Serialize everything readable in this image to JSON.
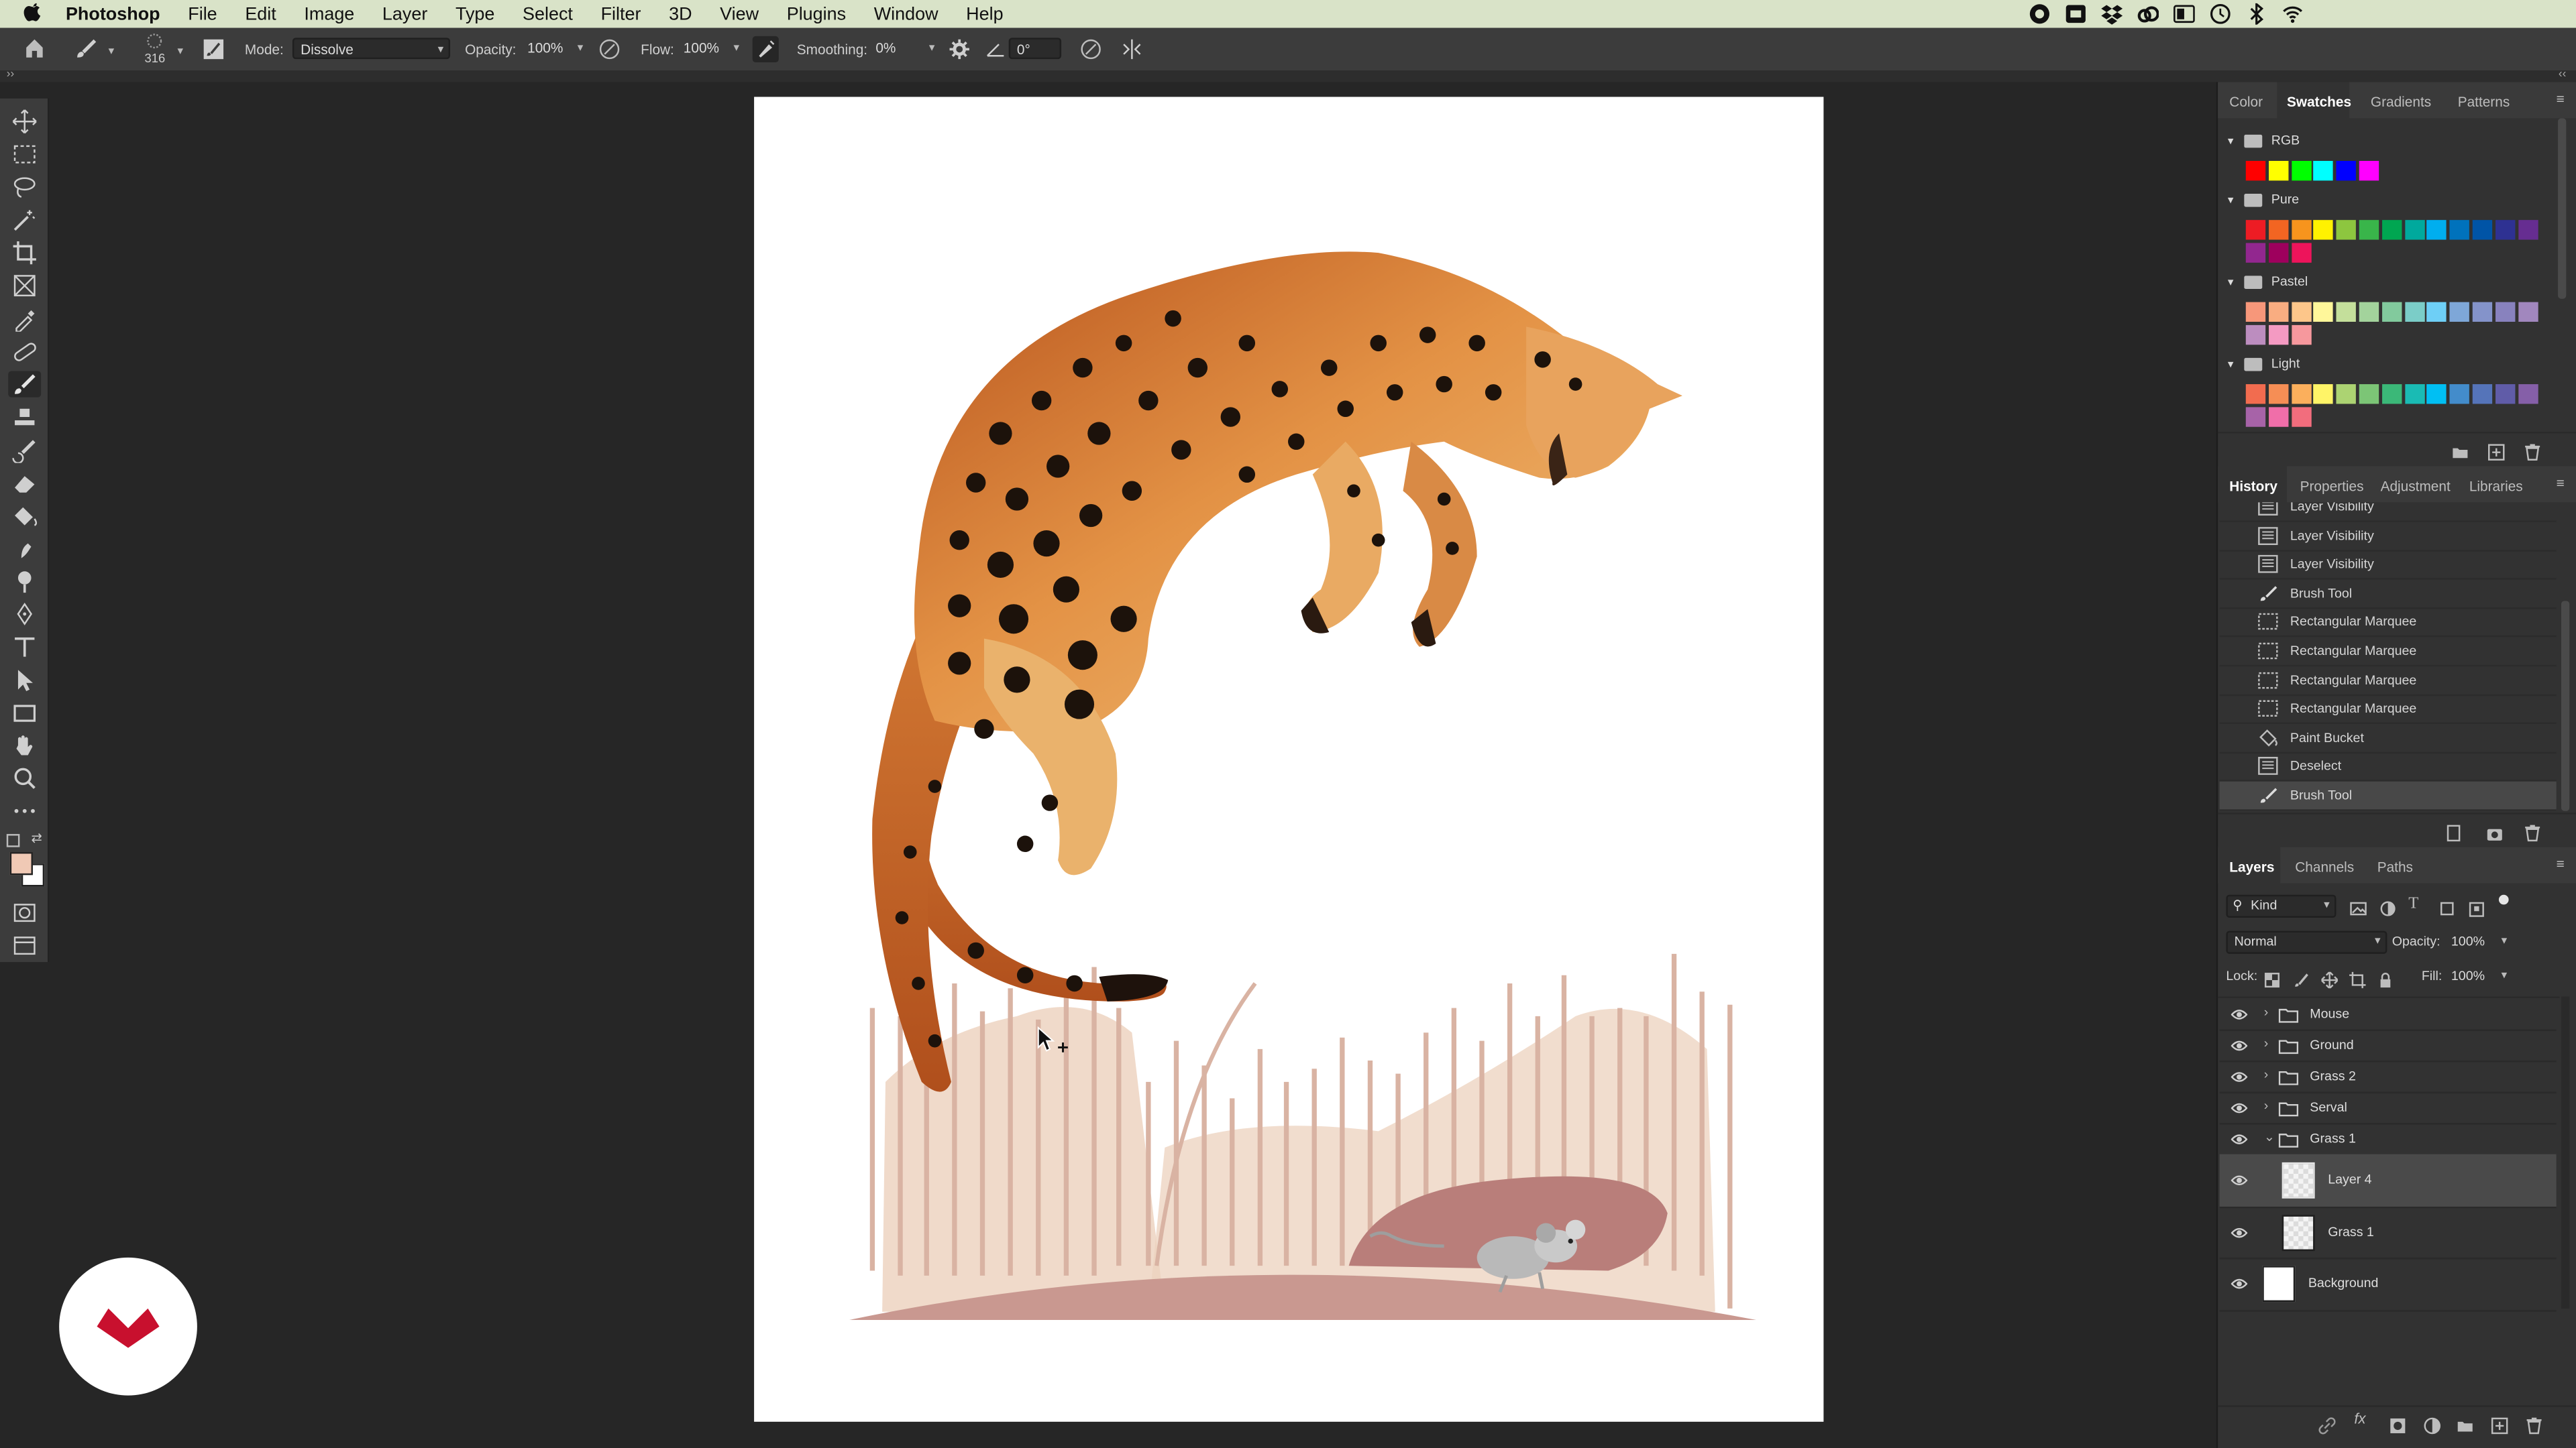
{
  "menubar": {
    "app_name": "Photoshop",
    "items": [
      "File",
      "Edit",
      "Image",
      "Layer",
      "Type",
      "Select",
      "Filter",
      "3D",
      "View",
      "Plugins",
      "Window",
      "Help"
    ],
    "bg_color": "#d9e3c8"
  },
  "options_bar": {
    "brush_size": "316",
    "mode_label": "Mode:",
    "mode_value": "Dissolve",
    "opacity_label": "Opacity:",
    "opacity_value": "100%",
    "flow_label": "Flow:",
    "flow_value": "100%",
    "smoothing_label": "Smoothing:",
    "smoothing_value": "0%",
    "angle_value": "0°"
  },
  "toolbar": {
    "tools": [
      "move-tool",
      "marquee-tool",
      "lasso-tool",
      "magic-wand-tool",
      "crop-tool",
      "frame-tool",
      "eyedropper-tool",
      "healing-tool",
      "brush-tool",
      "stamp-tool",
      "history-brush-tool",
      "eraser-tool",
      "paint-bucket-tool",
      "smudge-tool",
      "dodge-tool",
      "pen-tool",
      "type-tool",
      "path-selection-tool",
      "rectangle-tool",
      "hand-tool",
      "zoom-tool",
      "more-tools"
    ],
    "active_tool": "brush-tool",
    "foreground_color": "#f0c9b5",
    "background_color": "#ffffff"
  },
  "swatches_panel": {
    "tabs": [
      "Color",
      "Swatches",
      "Gradients",
      "Patterns"
    ],
    "active_tab": "Swatches",
    "groups": [
      {
        "name": "RGB",
        "colors": [
          "#ff0000",
          "#ffff00",
          "#00ff00",
          "#00ffff",
          "#0000ff",
          "#ff00ff"
        ]
      },
      {
        "name": "Pure",
        "colors": [
          "#ed1c24",
          "#f26522",
          "#f7941d",
          "#fff200",
          "#8dc63f",
          "#39b54a",
          "#00a651",
          "#00a99d",
          "#00aeef",
          "#0072bc",
          "#0054a6",
          "#2e3192",
          "#662d91",
          "#92278f",
          "#9e005d",
          "#ed145b"
        ]
      },
      {
        "name": "Pastel",
        "colors": [
          "#f7977a",
          "#f9ad81",
          "#fdc68a",
          "#fff79a",
          "#c4df9b",
          "#a3d39c",
          "#82ca9d",
          "#7bcdc8",
          "#6ecff6",
          "#7ea7d8",
          "#8493ca",
          "#8882be",
          "#a187be",
          "#bc8dbf",
          "#f49ac2",
          "#f6989d"
        ]
      },
      {
        "name": "Light",
        "colors": [
          "#f26c4f",
          "#f68e55",
          "#fbaf5c",
          "#fff467",
          "#acd372",
          "#7cc576",
          "#3bb878",
          "#1abbb4",
          "#00bff3",
          "#438ccb",
          "#5574b9",
          "#605ca8",
          "#855fa8",
          "#a763a8",
          "#f06ea9",
          "#f26d7d"
        ]
      }
    ]
  },
  "history_panel": {
    "tabs": [
      "History",
      "Properties",
      "Adjustment",
      "Libraries"
    ],
    "active_tab": "History",
    "items": [
      {
        "label": "Layer Visibility",
        "icon": "document-icon"
      },
      {
        "label": "Layer Visibility",
        "icon": "document-icon"
      },
      {
        "label": "Layer Visibility",
        "icon": "document-icon"
      },
      {
        "label": "Brush Tool",
        "icon": "brush-icon"
      },
      {
        "label": "Rectangular Marquee",
        "icon": "marquee-icon"
      },
      {
        "label": "Rectangular Marquee",
        "icon": "marquee-icon"
      },
      {
        "label": "Rectangular Marquee",
        "icon": "marquee-icon"
      },
      {
        "label": "Rectangular Marquee",
        "icon": "marquee-icon"
      },
      {
        "label": "Paint Bucket",
        "icon": "paint-bucket-icon"
      },
      {
        "label": "Deselect",
        "icon": "document-icon"
      },
      {
        "label": "Brush Tool",
        "icon": "brush-icon"
      }
    ],
    "selected_index": 10
  },
  "layers_panel": {
    "tabs": [
      "Layers",
      "Channels",
      "Paths"
    ],
    "active_tab": "Layers",
    "filter_label": "Kind",
    "blend_mode": "Normal",
    "opacity_label": "Opacity:",
    "opacity_value": "100%",
    "lock_label": "Lock:",
    "fill_label": "Fill:",
    "fill_value": "100%",
    "layers": [
      {
        "name": "Mouse",
        "type": "group",
        "expanded": false
      },
      {
        "name": "Ground",
        "type": "group",
        "expanded": false
      },
      {
        "name": "Grass 2",
        "type": "group",
        "expanded": false
      },
      {
        "name": "Serval",
        "type": "group",
        "expanded": false
      },
      {
        "name": "Grass 1",
        "type": "group",
        "expanded": true
      },
      {
        "name": "Layer 4",
        "type": "layer",
        "selected": true
      },
      {
        "name": "Grass 1",
        "type": "layer"
      },
      {
        "name": "Background",
        "type": "layer"
      }
    ]
  }
}
